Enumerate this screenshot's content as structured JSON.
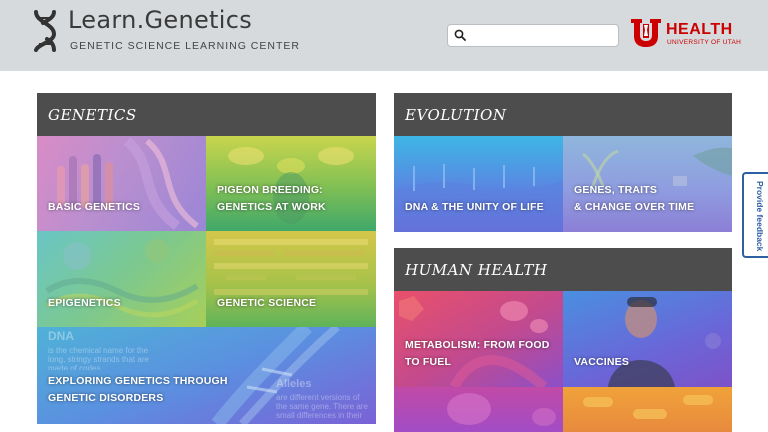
{
  "header": {
    "brand_title": "Learn.Genetics",
    "brand_subtitle": "GENETIC SCIENCE LEARNING CENTER",
    "search_placeholder": "",
    "partner_name": "HEALTH",
    "partner_subtitle": "UNIVERSITY OF UTAH",
    "partner_color": "#cc0000"
  },
  "sections": {
    "genetics": {
      "title": "GENETICS",
      "tiles": [
        {
          "label": "BASIC GENETICS"
        },
        {
          "label_line1": "PIGEON BREEDING:",
          "label_line2": "GENETICS AT WORK"
        },
        {
          "label": "EPIGENETICS"
        },
        {
          "label": "GENETIC SCIENCE"
        },
        {
          "label_line1": "EXPLORING GENETICS THROUGH",
          "label_line2": "GENETIC DISORDERS",
          "bg_text_dna_title": "DNA",
          "bg_text_dna_body": "is the chemical name for the long, stringy strands that are made of codes...",
          "bg_text_alleles_title": "Alleles",
          "bg_text_alleles_body": "are different versions of the same gene. There are small differences in their"
        }
      ]
    },
    "evolution": {
      "title": "EVOLUTION",
      "tiles": [
        {
          "label": "DNA & THE UNITY OF LIFE"
        },
        {
          "label_line1": "GENES, TRAITS",
          "label_line2": "& CHANGE OVER TIME"
        }
      ]
    },
    "human_health": {
      "title": "HUMAN HEALTH",
      "tiles": [
        {
          "label_line1": "METABOLISM: FROM FOOD",
          "label_line2": "TO FUEL"
        },
        {
          "label": "VACCINES"
        }
      ]
    }
  },
  "feedback": {
    "label": "Provide feedback"
  },
  "icons": [
    "dna-logo-icon",
    "search-icon",
    "u-health-logo-icon"
  ]
}
